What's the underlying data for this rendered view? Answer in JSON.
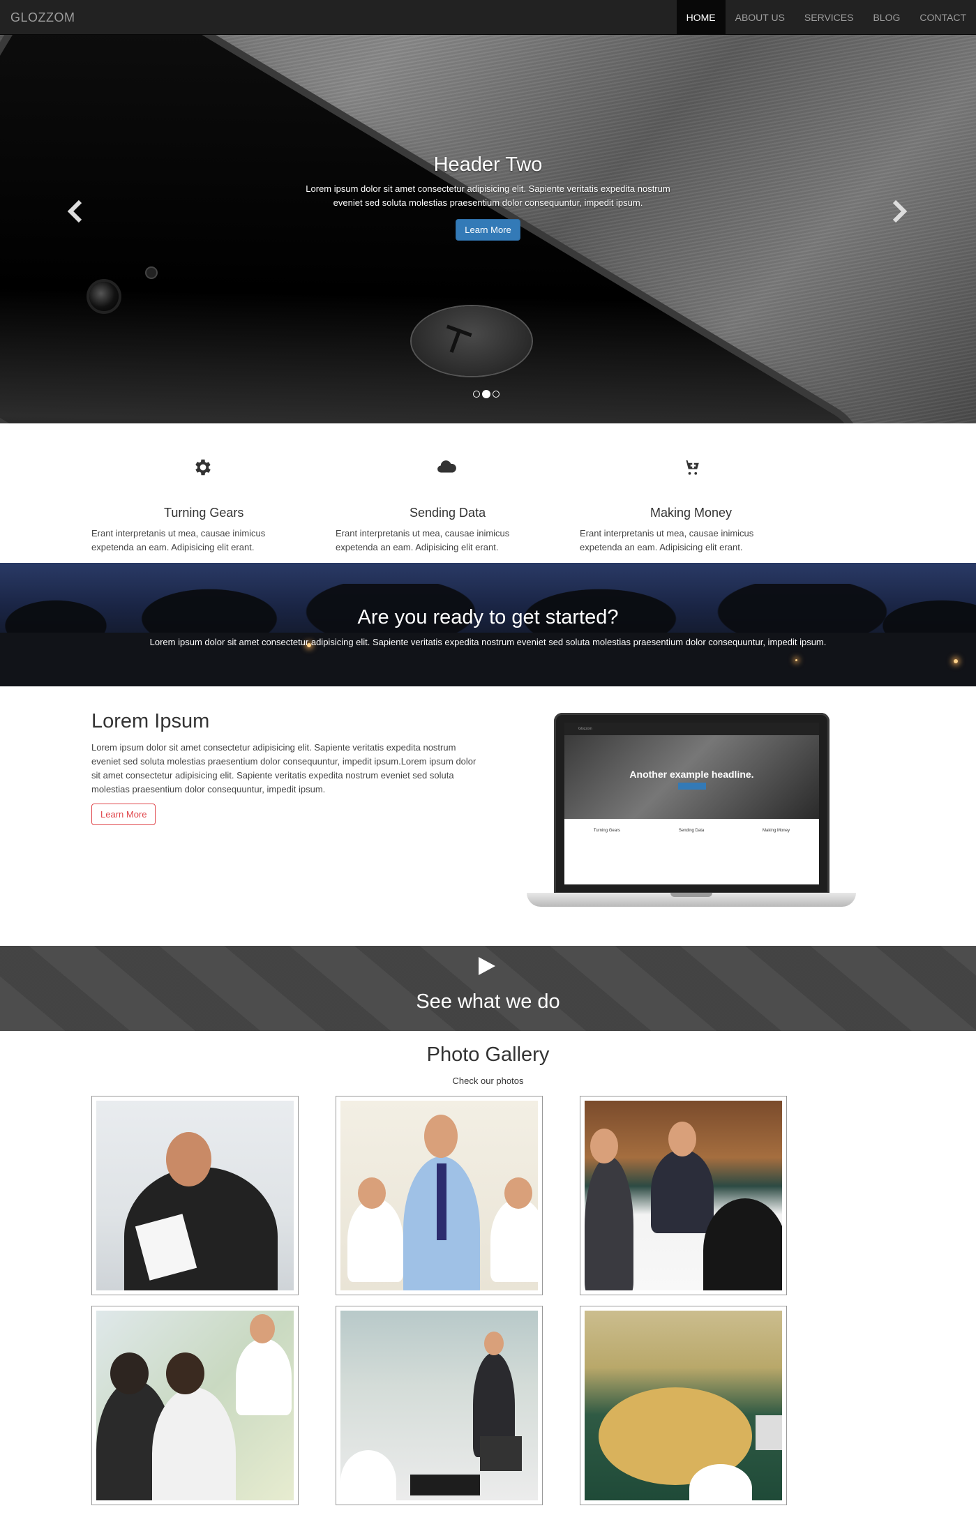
{
  "nav": {
    "brand": "GLOZZOM",
    "items": [
      "HOME",
      "ABOUT US",
      "SERVICES",
      "BLOG",
      "CONTACT"
    ],
    "active_index": 0
  },
  "hero": {
    "title": "Header Two",
    "text": "Lorem ipsum dolor sit amet consectetur adipisicing elit. Sapiente veritatis expedita nostrum eveniet sed soluta molestias praesentium dolor consequuntur, impedit ipsum.",
    "button": "Learn More",
    "prev_icon": "chevron-left-icon",
    "next_icon": "chevron-right-icon",
    "slide_count": 3,
    "active_slide": 1
  },
  "features": [
    {
      "icon": "gear-icon",
      "title": "Turning Gears",
      "text": "Erant interpretanis ut mea, causae inimicus expetenda an eam. Adipisicing elit erant."
    },
    {
      "icon": "cloud-icon",
      "title": "Sending Data",
      "text": "Erant interpretanis ut mea, causae inimicus expetenda an eam. Adipisicing elit erant."
    },
    {
      "icon": "cart-icon",
      "title": "Making Money",
      "text": "Erant interpretanis ut mea, causae inimicus expetenda an eam. Adipisicing elit erant."
    }
  ],
  "cta": {
    "title": "Are you ready to get started?",
    "text": "Lorem ipsum dolor sit amet consectetur adipisicing elit. Sapiente veritatis expedita nostrum eveniet sed soluta molestias praesentium dolor consequuntur, impedit ipsum."
  },
  "about": {
    "title": "Lorem Ipsum",
    "text": "Lorem ipsum dolor sit amet consectetur adipisicing elit. Sapiente veritatis expedita nostrum eveniet sed soluta molestias praesentium dolor consequuntur, impedit ipsum.Lorem ipsum dolor sit amet consectetur adipisicing elit. Sapiente veritatis expedita nostrum eveniet sed soluta molestias praesentium dolor consequuntur, impedit ipsum.",
    "button": "Learn More",
    "laptop_screen": {
      "brand": "Glozzom",
      "headline": "Another example headline.",
      "features": [
        "Turning Gears",
        "Sending Data",
        "Making Money"
      ]
    }
  },
  "video": {
    "icon": "play-icon",
    "title": "See what we do"
  },
  "gallery": {
    "title": "Photo Gallery",
    "subtitle": "Check our photos",
    "photos": [
      "business-presenter-photo",
      "office-man-standing-photo",
      "meeting-room-photo",
      "office-workers-photo",
      "open-office-photo",
      "round-desk-office-photo"
    ]
  },
  "colors": {
    "navbar": "#222222",
    "primary_button": "#337ab7",
    "outline_button": "#e0474c",
    "video_band": "#474747"
  }
}
